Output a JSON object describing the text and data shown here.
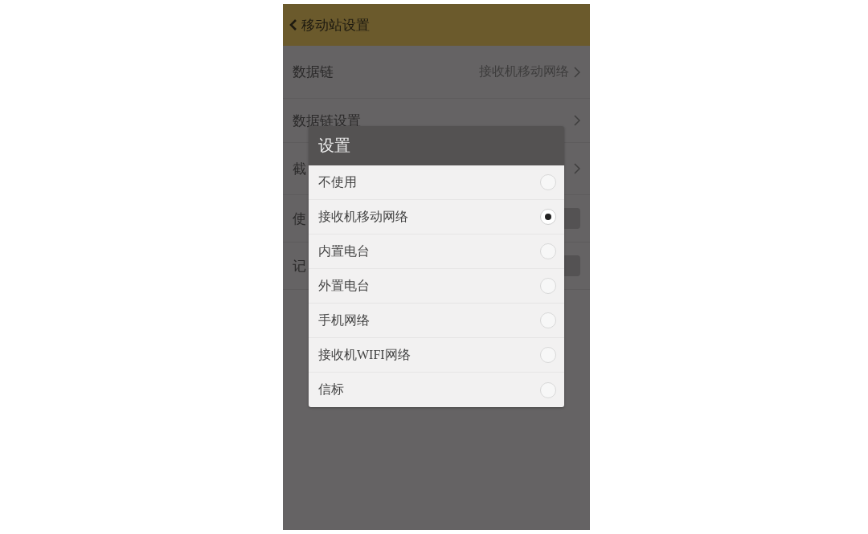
{
  "header": {
    "title": "移动站设置"
  },
  "settings": [
    {
      "kind": "link",
      "label": "数据链",
      "value": "接收机移动网络"
    },
    {
      "kind": "link",
      "label": "数据链设置"
    },
    {
      "kind": "link",
      "label": "截"
    },
    {
      "kind": "switch",
      "label": "使",
      "on": false
    },
    {
      "kind": "switch",
      "label": "记",
      "on": false
    }
  ],
  "dialog": {
    "title": "设置",
    "options": [
      {
        "label": "不使用",
        "selected": false
      },
      {
        "label": "接收机移动网络",
        "selected": true
      },
      {
        "label": "内置电台",
        "selected": false
      },
      {
        "label": "外置电台",
        "selected": false
      },
      {
        "label": "手机网络",
        "selected": false
      },
      {
        "label": "接收机WIFI网络",
        "selected": false
      },
      {
        "label": "信标",
        "selected": false
      }
    ]
  }
}
